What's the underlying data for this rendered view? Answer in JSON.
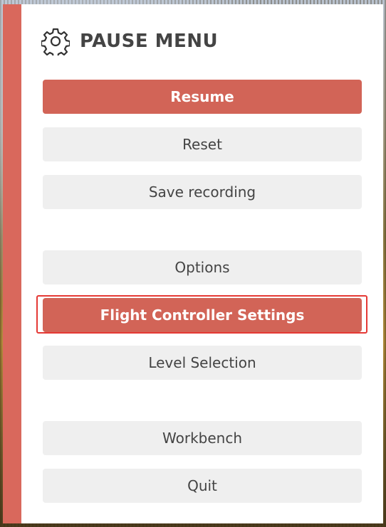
{
  "header": {
    "icon": "gear-icon",
    "title": "PAUSE MENU"
  },
  "menu": {
    "resume": "Resume",
    "reset": "Reset",
    "save_recording": "Save recording",
    "options": "Options",
    "flight_controller_settings": "Flight Controller Settings",
    "level_selection": "Level Selection",
    "workbench": "Workbench",
    "quit": "Quit"
  },
  "colors": {
    "accent": "#d26457",
    "button_bg": "#efefef",
    "text": "#444444",
    "highlight_border": "#e53935"
  }
}
